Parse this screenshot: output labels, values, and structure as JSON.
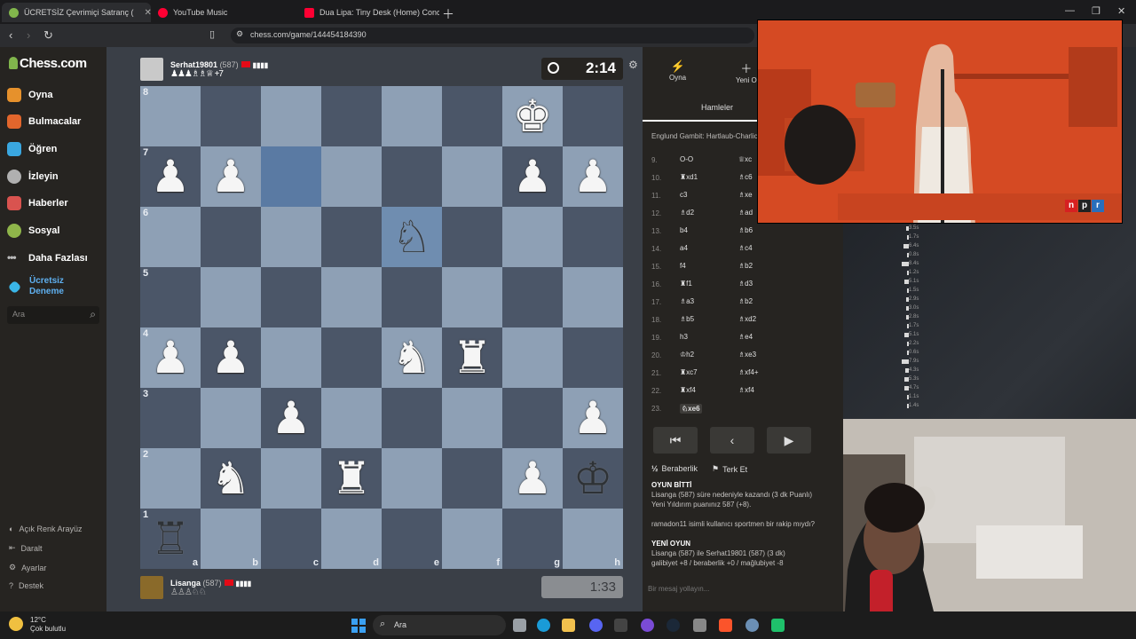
{
  "browser": {
    "tabs": [
      {
        "title": "ÜCRETSİZ Çevrimiçi Satranç (",
        "active": true
      },
      {
        "title": "YouTube Music",
        "active": false
      },
      {
        "title": "Dua Lipa: Tiny Desk (Home) Conc",
        "active": false
      }
    ],
    "url": "chess.com/game/144454184390"
  },
  "sidebar": {
    "logo": "Chess.com",
    "items": [
      {
        "label": "Oyna",
        "icon": "pawn-icon"
      },
      {
        "label": "Bulmacalar",
        "icon": "puzzle-icon"
      },
      {
        "label": "Öğren",
        "icon": "learn-icon"
      },
      {
        "label": "İzleyin",
        "icon": "watch-icon"
      },
      {
        "label": "Haberler",
        "icon": "news-icon"
      },
      {
        "label": "Sosyal",
        "icon": "social-icon"
      },
      {
        "label": "Daha Fazlası",
        "icon": "more-icon"
      }
    ],
    "trial_line1": "Ücretsiz",
    "trial_line2": "Deneme",
    "search_placeholder": "Ara",
    "bottom": [
      "Açık Renk Arayüz",
      "Daralt",
      "Ayarlar",
      "Destek"
    ]
  },
  "top_player": {
    "name": "Serhat19801",
    "rating": "(587)",
    "captured": "♟♟♟♗♗♕ +7",
    "clock": "2:14"
  },
  "bottom_player": {
    "name": "Lisanga",
    "rating": "(587)",
    "captured": "♙♙♙♘♘",
    "clock": "1:33"
  },
  "board": {
    "ranks": [
      "8",
      "7",
      "6",
      "5",
      "4",
      "3",
      "2",
      "1"
    ],
    "files": [
      "a",
      "b",
      "c",
      "d",
      "e",
      "f",
      "g",
      "h"
    ],
    "pieces": [
      [
        "",
        "",
        "",
        "",
        "",
        "",
        "bK",
        ""
      ],
      [
        "bP",
        "bP",
        "",
        "",
        "",
        "",
        "bP",
        "bP"
      ],
      [
        "",
        "",
        "",
        "",
        "wN",
        "",
        "",
        ""
      ],
      [
        "",
        "",
        "",
        "",
        "",
        "",
        "",
        ""
      ],
      [
        "bP",
        "bP",
        "",
        "",
        "bN",
        "bR",
        "",
        ""
      ],
      [
        "",
        "",
        "bP",
        "",
        "",
        "",
        "",
        "bP"
      ],
      [
        "",
        "bN",
        "",
        "bR",
        "",
        "",
        "bP",
        "wK"
      ],
      [
        "wR",
        "",
        "",
        "",
        "",
        "",
        "",
        ""
      ]
    ],
    "highlights": [
      "c7",
      "e6"
    ]
  },
  "panel": {
    "tab_play": "Oyna",
    "tab_new": "Yeni O",
    "tab_moves": "Hamleler",
    "opening": "Englund Gambit: Hartlaub-Charlick",
    "moves": [
      {
        "n": "9.",
        "w": "O-O",
        "b": "♕xc"
      },
      {
        "n": "10.",
        "w": "♜xd1",
        "b": "♗c6"
      },
      {
        "n": "11.",
        "w": "c3",
        "b": "♗xe"
      },
      {
        "n": "12.",
        "w": "♗d2",
        "b": "♗ad"
      },
      {
        "n": "13.",
        "w": "b4",
        "b": "♗b6"
      },
      {
        "n": "14.",
        "w": "a4",
        "b": "♗c4"
      },
      {
        "n": "15.",
        "w": "f4",
        "b": "♗b2"
      },
      {
        "n": "16.",
        "w": "♜f1",
        "b": "♗d3"
      },
      {
        "n": "17.",
        "w": "♗a3",
        "b": "♗b2"
      },
      {
        "n": "18.",
        "w": "♗b5",
        "b": "♗xd2"
      },
      {
        "n": "19.",
        "w": "h3",
        "b": "♗e4"
      },
      {
        "n": "20.",
        "w": "♔h2",
        "b": "♗xe3"
      },
      {
        "n": "21.",
        "w": "♜xc7",
        "b": "♗xf4+"
      },
      {
        "n": "22.",
        "w": "♜xf4",
        "b": "♗xf4"
      },
      {
        "n": "23.",
        "w": "♘xe6",
        "b": ""
      }
    ],
    "draw_label": "Beraberlik",
    "resign_label": "Terk Et",
    "chat": [
      {
        "bold": "OYUN BİTTİ",
        "text": ""
      },
      {
        "bold": "",
        "text": "Lisanga (587) süre nedeniyle kazandı (3 dk Puanlı)"
      },
      {
        "bold": "",
        "text": "Yeni Yıldırım puanınız 587 (+8)."
      },
      {
        "bold": "",
        "text": ""
      },
      {
        "bold": "",
        "text": "ramadon11 isimli kullanıcı sportmen bir rakip mıydı?"
      },
      {
        "bold": "",
        "text": ""
      },
      {
        "bold": "YENİ OYUN",
        "text": ""
      },
      {
        "bold": "",
        "text": "Lisanga (587) ile Serhat19801 (587) (3 dk)"
      },
      {
        "bold": "",
        "text": "galibiyet +8 / beraberlik +0 / mağlubiyet -8"
      }
    ],
    "chat_placeholder": "Bir mesaj yollayın..."
  },
  "move_times": [
    "3.5s",
    "1.7s",
    "6.4s",
    "0.8s",
    "8.4s",
    "1.2s",
    "5.1s",
    "1.5s",
    "2.9s",
    "3.0s",
    "2.8s",
    "1.7s",
    "5.1s",
    "2.2s",
    "0.6s",
    "7.9s",
    "4.3s",
    "5.3s",
    "4.7s",
    "1.1s",
    "1.4s"
  ],
  "overlay": {
    "npr": [
      "n",
      "p",
      "r"
    ]
  },
  "taskbar": {
    "temp": "12°C",
    "weather": "Çok bulutlu",
    "search": "Ara"
  },
  "colors": {
    "light_square": "#8ea0b5",
    "dark_square": "#4b5668",
    "chess_green": "#81b64c",
    "trial_blue": "#5fb0f0"
  }
}
